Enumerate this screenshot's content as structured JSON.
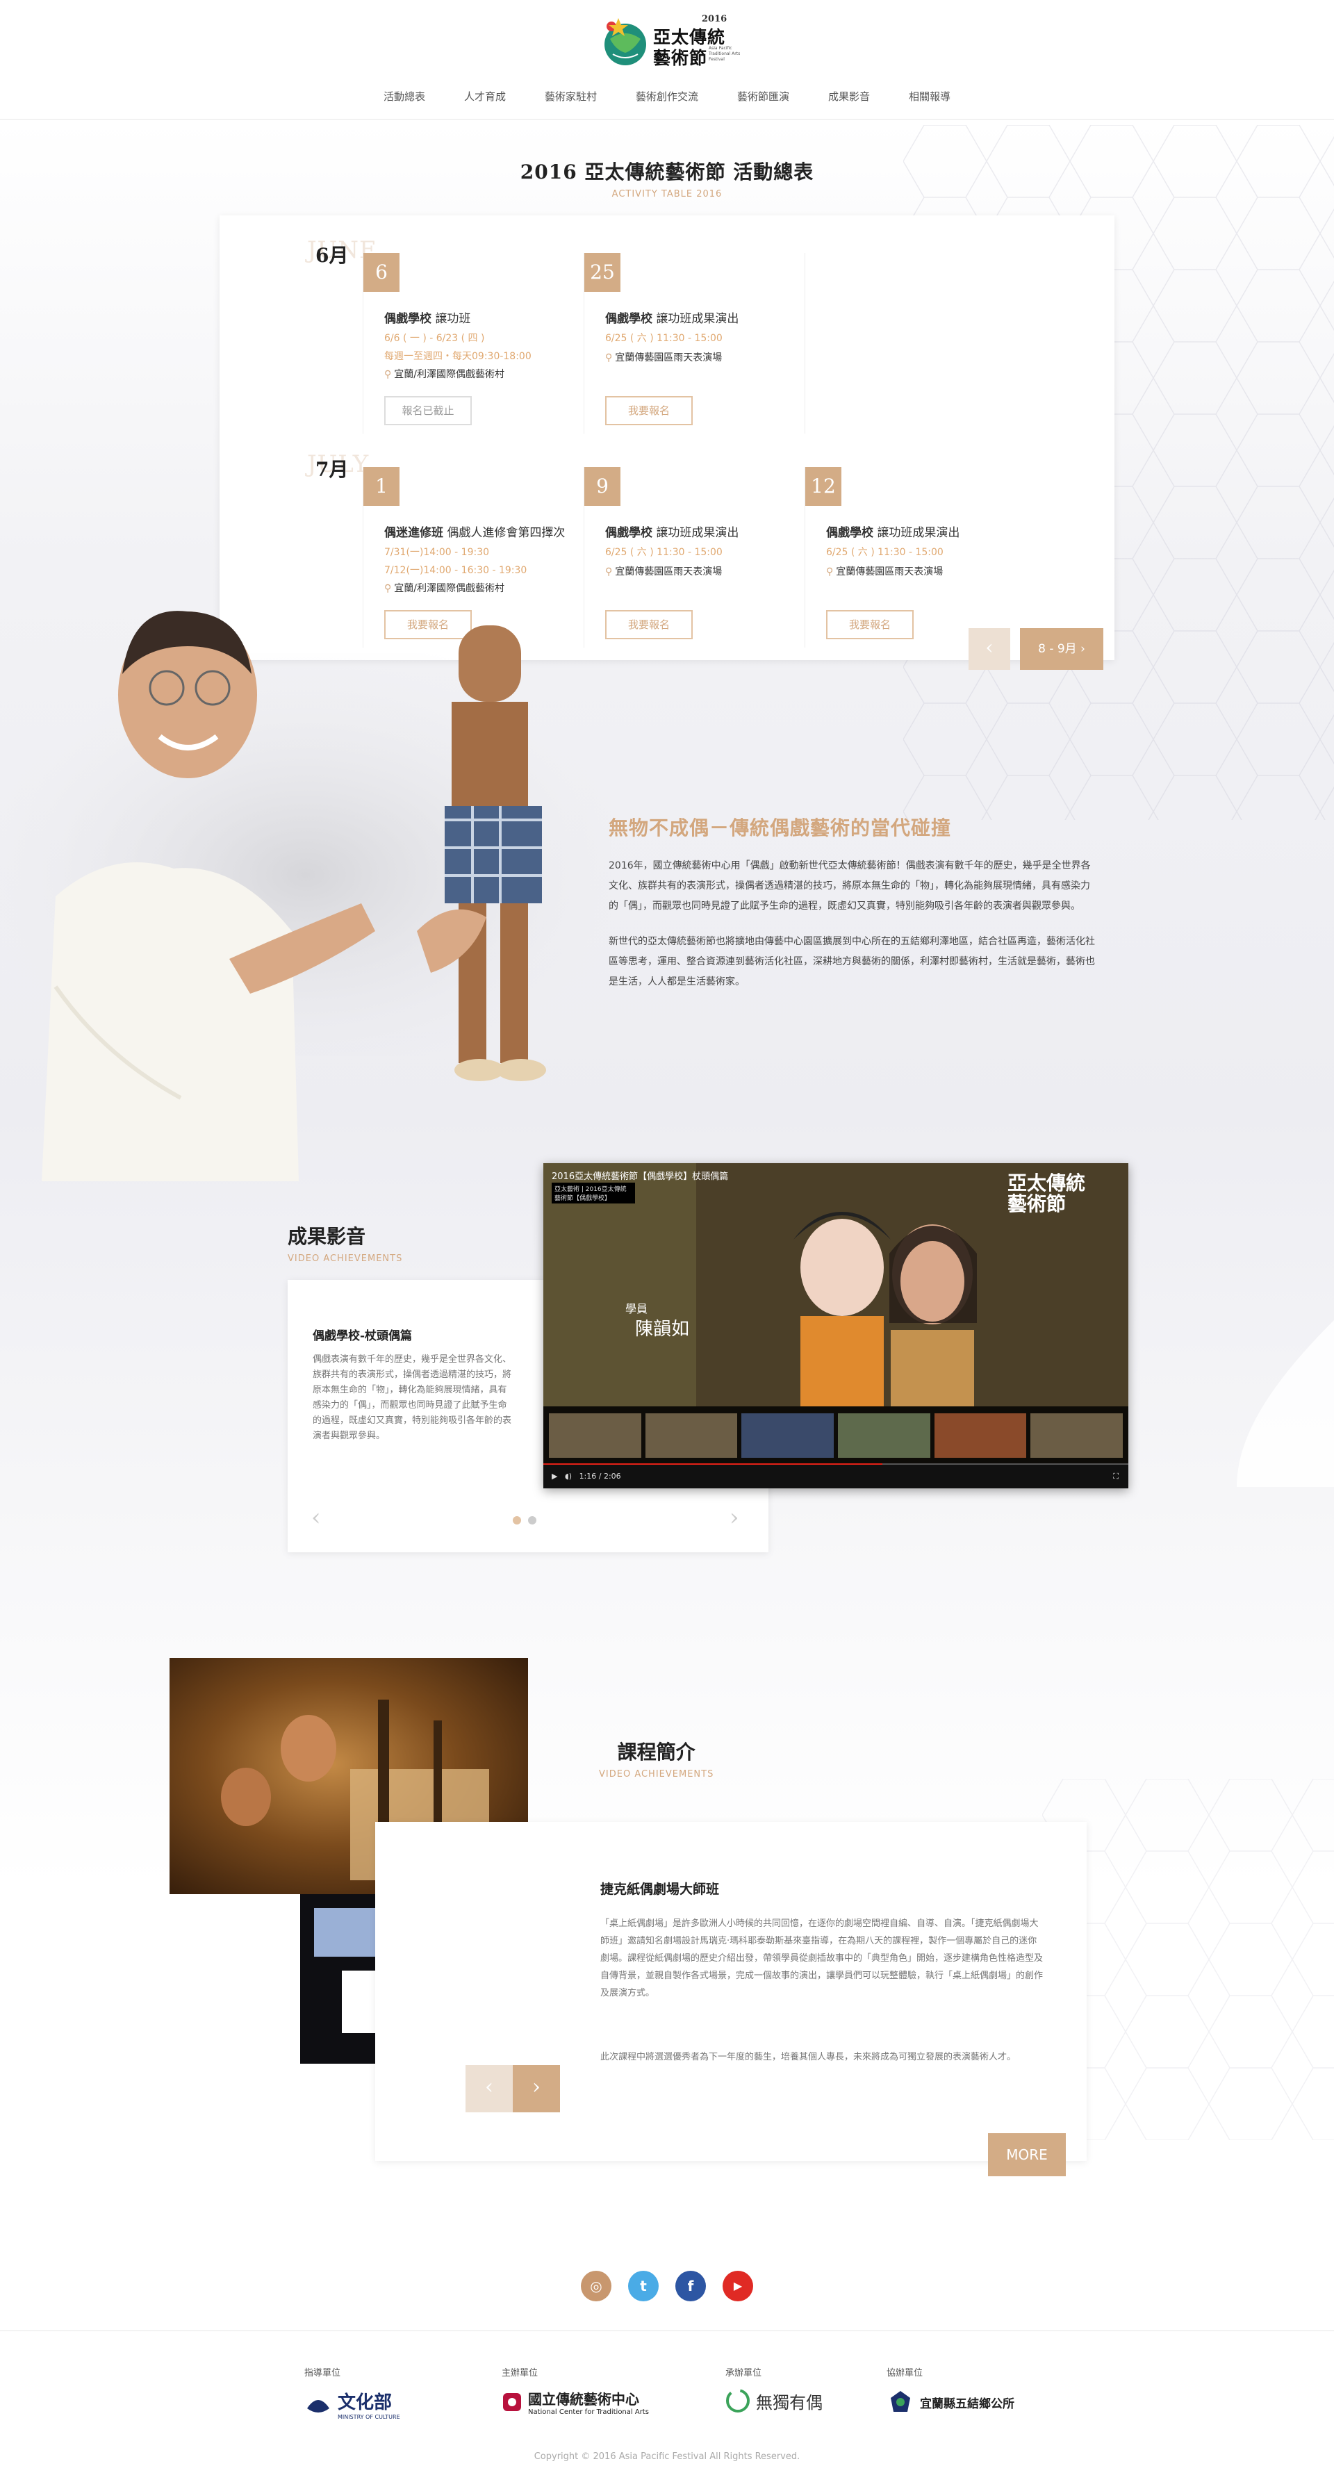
{
  "header": {
    "logo": {
      "year": "2016",
      "name_line1": "亞太傳統",
      "name_line2": "藝術節",
      "en": "Asia Pacific Traditional Arts Festival"
    },
    "nav": [
      "活動總表",
      "人才育成",
      "藝術家駐村",
      "藝術創作交流",
      "藝術節匯演",
      "成果影音",
      "相關報導"
    ]
  },
  "activity": {
    "title": "2016 亞太傳統藝術節 活動總表",
    "subtitle": "ACTIVITY TABLE 2016",
    "months": [
      {
        "ghost": "JUNE",
        "label": "6月",
        "events": [
          {
            "day": "6",
            "category": "偶戲學校",
            "name": "譲功班",
            "dates": [
              "6/6 ( 一 ) - 6/23 ( 四 )",
              "每週一至週四・每天09:30-18:00"
            ],
            "location": "宜蘭/利澤國際偶戲藝術村",
            "button": "報名已截止"
          },
          {
            "day": "25",
            "category": "偶戲學校",
            "name": "譲功班成果演出",
            "dates": [
              "6/25 ( 六 ) 11:30 - 15:00"
            ],
            "location": "宜蘭傳藝園區雨天表演場",
            "button": "我要報名"
          }
        ]
      },
      {
        "ghost": "JULY",
        "label": "7月",
        "events": [
          {
            "day": "1",
            "category": "偶迷進修班",
            "name": "偶戲人進修會第四擇次",
            "dates": [
              "7/31(一)14:00 - 19:30",
              "7/12(一)14:00 - 16:30 - 19:30"
            ],
            "location": "宜蘭/利澤國際偶戲藝術村",
            "button": "我要報名"
          },
          {
            "day": "9",
            "category": "偶戲學校",
            "name": "譲功班成果演出",
            "dates": [
              "6/25 ( 六 ) 11:30 - 15:00"
            ],
            "location": "宜蘭傳藝園區雨天表演場",
            "button": "我要報名"
          },
          {
            "day": "12",
            "category": "偶戲學校",
            "name": "譲功班成果演出",
            "dates": [
              "6/25 ( 六 ) 11:30 - 15:00"
            ],
            "location": "宜蘭傳藝園區雨天表演場",
            "button": "我要報名"
          }
        ]
      }
    ],
    "pager": {
      "prev": "‹",
      "next": "8 - 9月"
    }
  },
  "intro": {
    "title": "無物不成偶－傳統偶戲藝術的當代碰撞",
    "p1": "2016年，國立傳統藝術中心用「偶戲」啟動新世代亞太傳統藝術節！偶戲表演有數千年的歷史，幾乎是全世界各文化、族群共有的表演形式，操偶者透過精湛的技巧，將原本無生命的「物」，轉化為能夠展現情緒，具有感染力的「偶」，而觀眾也同時見證了此賦予生命的過程，既虛幻又真實，特別能夠吸引各年齡的表演者與觀眾參與。",
    "p2": "新世代的亞太傳統藝術節也將擴地由傳藝中心園區擴展到中心所在的五結鄉利澤地區，結合社區再造，藝術活化社區等思考，運用、整合資源連到藝術活化社區，深耕地方與藝術的關係，利澤村即藝術村，生活就是藝術，藝術也是生活，人人都是生活藝術家。"
  },
  "video": {
    "title": "成果影音",
    "subtitle": "VIDEO ACHIEVEMENTS",
    "card_title": "偶戲學校-杖頭偶篇",
    "card_text": "偶戲表演有數千年的歷史，幾乎是全世界各文化、族群共有的表演形式，操偶者透過精湛的技巧，將原本無生命的「物」，轉化為能夠展現情緒，具有感染力的「偶」，而觀眾也同時見證了此賦予生命的過程，既虛幻又真實，特別能夠吸引各年齡的表演者與觀眾參與。",
    "player": {
      "title": "2016亞太傳統藝術節【偶戲學校】杖頭偶篇",
      "badge": "亞太藝術 | 2016亞太傳統藝術節【偶戲學校】",
      "caption_role": "學員",
      "caption_name": "陳韻如",
      "logo_line1": "亞太傳統",
      "logo_line2": "藝術節",
      "time": "1:16 / 2:06",
      "progress": 0.58
    }
  },
  "course": {
    "title": "課程簡介",
    "subtitle": "VIDEO ACHIEVEMENTS",
    "card_title": "捷克紙偶劇場大師班",
    "p1": "「桌上紙偶劇場」是許多歐洲人小時候的共同回憶，在逐你的劇場空間裡自編、自導、自演。「捷克紙偶劇場大師班」邀請知名劇場設計馬瑞克‧瑪科耶泰勒斯基來臺指導，在為期八天的課程裡，製作一個專屬於自己的迷你劇場。課程從紙偶劇場的歷史介紹出發，帶領學員從劇插故事中的「典型角色」開始，逐步建構角色性格造型及自傳背景，並親自製作各式場景，完成一個故事的演出，讓學員們可以玩整體驗，執行「桌上紙偶劇場」的創作及展演方式。",
    "p2": "此次課程中將選選優秀者為下一年度的藝生，培養其個人專長，未來將成為可獨立發展的表演藝術人才。",
    "prev": "‹",
    "next": "›",
    "more": "MORE"
  },
  "social": [
    {
      "icon": "instagram-icon",
      "glyph": "◎",
      "color": "#c8976e"
    },
    {
      "icon": "twitter-icon",
      "glyph": "t",
      "color": "#4aabe6"
    },
    {
      "icon": "facebook-icon",
      "glyph": "f",
      "color": "#2d56a3"
    },
    {
      "icon": "youtube-icon",
      "glyph": "▶",
      "color": "#e02a24"
    }
  ],
  "sponsors": [
    {
      "label": "指導單位",
      "name": "文化部",
      "en": "MINISTRY OF CULTURE"
    },
    {
      "label": "主辦單位",
      "name": "國立傳統藝術中心",
      "en": "National Center for Traditional Arts"
    },
    {
      "label": "承辦單位",
      "name": "無獨有偶"
    },
    {
      "label": "協辦單位",
      "name": "宜蘭縣五結鄉公所"
    }
  ],
  "copyright": "Copyright © 2016 Asia Pacific Festival All Rights Reserved."
}
